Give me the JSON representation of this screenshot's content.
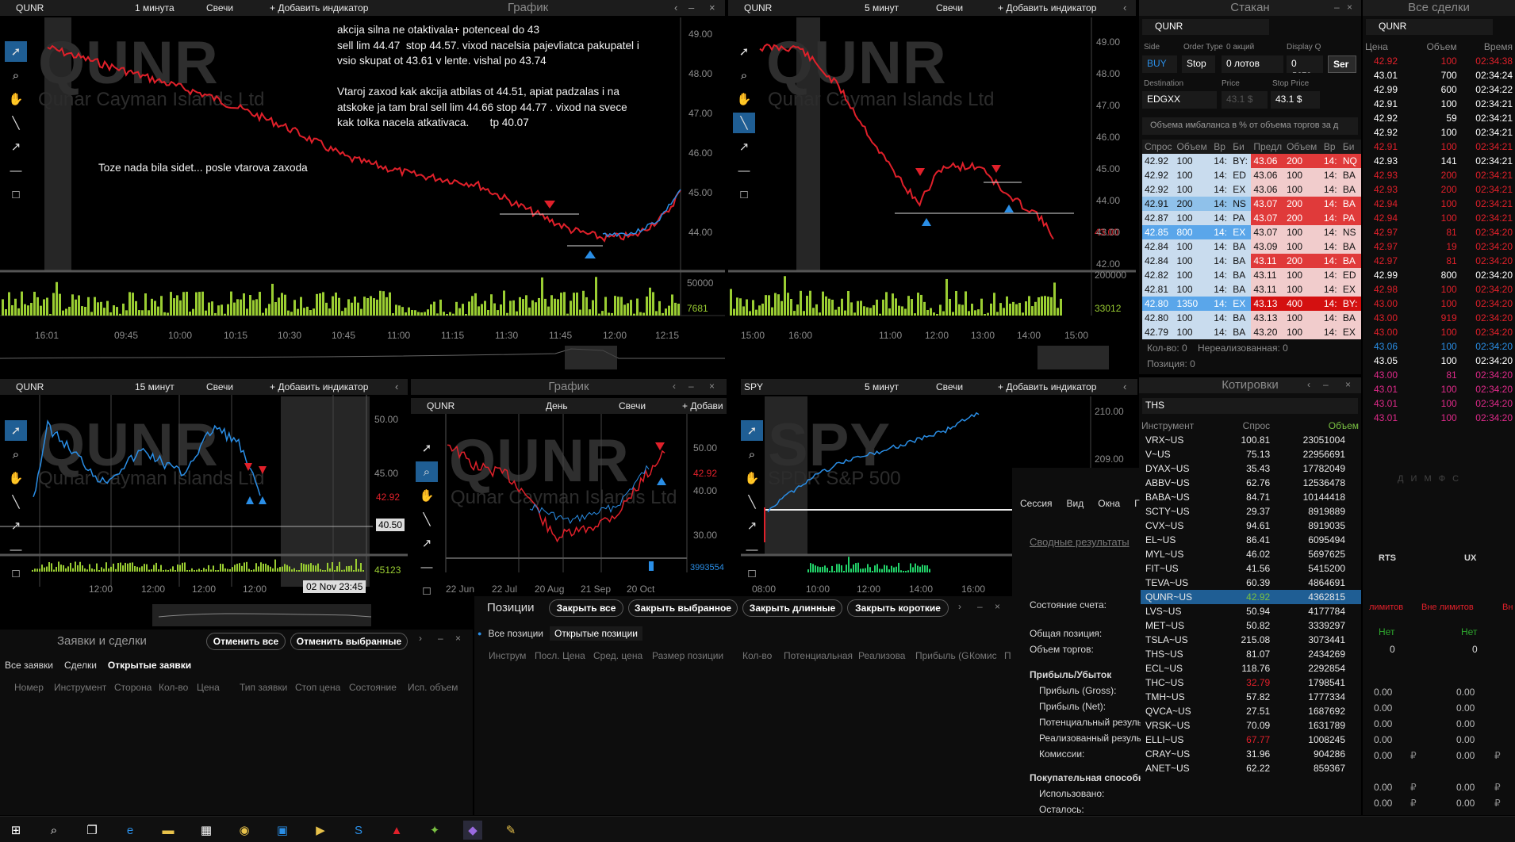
{
  "colors": {
    "up": "#2a8ee6",
    "down": "#e0202a",
    "vol": "#9acd32",
    "accent": "#1f5e94",
    "bid": "#cfe3f5",
    "ask": "#f0c8c8"
  },
  "chart1": {
    "symbol": "QUNR",
    "interval": "1 минута",
    "type": "Свечи",
    "add": "+ Добавить индикатор",
    "title": "График",
    "wm_symbol": "QUNR",
    "wm_name": "Qunar Cayman Islands Ltd",
    "prices": [
      "49.00",
      "48.00",
      "47.00",
      "46.00",
      "45.00",
      "44.00"
    ],
    "vol_labels": [
      "50000",
      "7681"
    ],
    "times": [
      "16:01",
      "09:45",
      "10:00",
      "10:15",
      "10:30",
      "10:45",
      "11:00",
      "11:15",
      "11:30",
      "11:45",
      "12:00",
      "12:15"
    ],
    "note1": "akcija silna ne otaktivala+ potenceal do 43\nsell lim 44.47  stop 44.57. vixod nacelsia pajevliatca pakupatel i\nvsio skupat ot 43.61 v lente. vishal po 43.74\n\nVtaroj zaxod kak akcija atbilas ot 44.51, apiat padzalas i na\natskoke ja tam bral sell lim 44.66 stop 44.77 . vixod na svece\nkak tolka nacela atkativaca.       tp 40.07",
    "note2": "Toze nada bila sidet... posle vtarova zaxoda"
  },
  "chart2": {
    "symbol": "QUNR",
    "interval": "5 минут",
    "type": "Свечи",
    "add": "+ Добавить индикатор",
    "wm_symbol": "QUNR",
    "wm_name": "Qunar Cayman Islands Ltd",
    "prices": [
      "49.00",
      "48.00",
      "47.00",
      "46.00",
      "45.00",
      "44.00",
      "43.00",
      "42.00"
    ],
    "last": "43.00",
    "vol_labels": [
      "200000",
      "33012"
    ],
    "times": [
      "15:00",
      "16:00",
      "11:00",
      "12:00",
      "13:00",
      "14:00",
      "15:00"
    ]
  },
  "chart3": {
    "symbol": "QUNR",
    "interval": "15 минут",
    "type": "Свечи",
    "add": "+ Добавить индикатор",
    "wm_symbol": "QUNR",
    "wm_name": "Qunar Cayman Islands Ltd",
    "prices": [
      "50.00",
      "45.00"
    ],
    "last": "42.92",
    "cursor": "40.50",
    "vol_label": "45123",
    "times": [
      "12:00",
      "12:00",
      "12:00",
      "12:00"
    ],
    "tooltip": "02 Nov 23:45"
  },
  "chart4": {
    "symbol": "QUNR",
    "title": "График",
    "interval": "День",
    "type": "Свечи",
    "add": "+ Добави",
    "wm_symbol": "QUNR",
    "wm_name": "Qunar Cayman Islands Ltd",
    "prices": [
      "50.00",
      "40.00",
      "30.00"
    ],
    "last": "42.92",
    "vol_label": "3993554",
    "times": [
      "22 Jun",
      "22 Jul",
      "20 Aug",
      "21 Sep",
      "20 Oct"
    ]
  },
  "chart5": {
    "symbol": "SPY",
    "interval": "5 минут",
    "type": "Свечи",
    "add": "+ Добавить индикатор",
    "wm_symbol": "SPY",
    "wm_name": "SPDR S&P 500",
    "prices": [
      "210.00",
      "209.00"
    ],
    "times": [
      "08:00",
      "10:00",
      "12:00",
      "14:00",
      "16:00"
    ]
  },
  "dom": {
    "title": "Стакан",
    "symbol": "QUNR",
    "side_label": "Side",
    "side": "BUY",
    "ordertype_label": "Order Type",
    "ordertype": "Stop",
    "qty_label": "0 акций",
    "qty": "0 лотов",
    "display_label": "Display Q",
    "display": "0 лото",
    "send": "Ser",
    "dest_label": "Destination",
    "dest": "EDGXX",
    "price_label": "Price",
    "price": "43.1 $",
    "stop_label": "Stop Price",
    "stop": "43.1 $",
    "imbalance": "Объема имбаланса в % от объема торгов за д",
    "headers": [
      "Спрос",
      "Объем",
      "Вр",
      "Би",
      "Предл",
      "Объем",
      "Вр",
      "Би"
    ],
    "rows": [
      [
        "42.92",
        "100",
        "14:",
        "BY:",
        "43.06",
        "200",
        "14:",
        "NQ"
      ],
      [
        "42.92",
        "100",
        "14:",
        "ED",
        "43.06",
        "100",
        "14:",
        "BA"
      ],
      [
        "42.92",
        "100",
        "14:",
        "EX",
        "43.06",
        "100",
        "14:",
        "BA"
      ],
      [
        "42.91",
        "200",
        "14:",
        "NS",
        "43.07",
        "200",
        "14:",
        "BA"
      ],
      [
        "42.87",
        "100",
        "14:",
        "PA",
        "43.07",
        "200",
        "14:",
        "PA"
      ],
      [
        "42.85",
        "800",
        "14:",
        "EX",
        "43.07",
        "100",
        "14:",
        "NS"
      ],
      [
        "42.84",
        "100",
        "14:",
        "BA",
        "43.09",
        "100",
        "14:",
        "BA"
      ],
      [
        "42.84",
        "100",
        "14:",
        "BA",
        "43.11",
        "200",
        "14:",
        "BA"
      ],
      [
        "42.82",
        "100",
        "14:",
        "BA",
        "43.11",
        "100",
        "14:",
        "ED"
      ],
      [
        "42.81",
        "100",
        "14:",
        "BA",
        "43.11",
        "100",
        "14:",
        "EX"
      ],
      [
        "42.80",
        "1350",
        "14:",
        "EX",
        "43.13",
        "400",
        "14:",
        "BY:"
      ],
      [
        "42.80",
        "100",
        "14:",
        "BA",
        "43.13",
        "100",
        "14:",
        "BA"
      ],
      [
        "42.79",
        "100",
        "14:",
        "BA",
        "43.20",
        "100",
        "14:",
        "EX"
      ]
    ],
    "qty_footer": "Кол-во: 0",
    "unreal": "Нереализованная: 0",
    "pos": "Позиция: 0"
  },
  "trades": {
    "title": "Все сделки",
    "symbol": "QUNR",
    "headers": [
      "Цена",
      "Объем",
      "Время"
    ],
    "rows": [
      [
        "42.92",
        "100",
        "02:34:38",
        "r"
      ],
      [
        "43.01",
        "700",
        "02:34:24",
        "w"
      ],
      [
        "42.99",
        "600",
        "02:34:22",
        "w"
      ],
      [
        "42.91",
        "100",
        "02:34:21",
        "w"
      ],
      [
        "42.92",
        "59",
        "02:34:21",
        "w"
      ],
      [
        "42.92",
        "100",
        "02:34:21",
        "w"
      ],
      [
        "42.91",
        "100",
        "02:34:21",
        "r"
      ],
      [
        "42.93",
        "141",
        "02:34:21",
        "w"
      ],
      [
        "42.93",
        "200",
        "02:34:21",
        "r"
      ],
      [
        "42.93",
        "200",
        "02:34:21",
        "r"
      ],
      [
        "42.94",
        "100",
        "02:34:21",
        "r"
      ],
      [
        "42.94",
        "100",
        "02:34:21",
        "r"
      ],
      [
        "42.97",
        "81",
        "02:34:20",
        "r"
      ],
      [
        "42.97",
        "19",
        "02:34:20",
        "r"
      ],
      [
        "42.97",
        "81",
        "02:34:20",
        "r"
      ],
      [
        "42.99",
        "800",
        "02:34:20",
        "w"
      ],
      [
        "42.98",
        "100",
        "02:34:20",
        "r"
      ],
      [
        "43.00",
        "100",
        "02:34:20",
        "r"
      ],
      [
        "43.00",
        "919",
        "02:34:20",
        "r"
      ],
      [
        "43.00",
        "100",
        "02:34:20",
        "r"
      ],
      [
        "43.06",
        "100",
        "02:34:20",
        "b"
      ],
      [
        "43.05",
        "100",
        "02:34:20",
        "w"
      ],
      [
        "43.00",
        "81",
        "02:34:20",
        "m"
      ],
      [
        "43.01",
        "100",
        "02:34:20",
        "m"
      ],
      [
        "43.01",
        "100",
        "02:34:20",
        "m"
      ],
      [
        "43.01",
        "100",
        "02:34:20",
        "m"
      ]
    ],
    "footer": "Д И М Ф С"
  },
  "quotes": {
    "title": "Котировки",
    "list": "THS",
    "headers": [
      "Инструмент",
      "Спрос",
      "Объем"
    ],
    "rows": [
      [
        "VRX~US",
        "100.81",
        "23051004"
      ],
      [
        "V~US",
        "75.13",
        "22956691"
      ],
      [
        "DYAX~US",
        "35.43",
        "17782049"
      ],
      [
        "ABBV~US",
        "62.76",
        "12536478"
      ],
      [
        "BABA~US",
        "84.71",
        "10144418"
      ],
      [
        "SCTY~US",
        "29.37",
        "8919889"
      ],
      [
        "CVX~US",
        "94.61",
        "8919035"
      ],
      [
        "EL~US",
        "86.41",
        "6095494"
      ],
      [
        "MYL~US",
        "46.02",
        "5697625"
      ],
      [
        "FIT~US",
        "41.56",
        "5415200"
      ],
      [
        "TEVA~US",
        "60.39",
        "4864691"
      ],
      [
        "QUNR~US",
        "42.92",
        "4362815"
      ],
      [
        "LVS~US",
        "50.94",
        "4177784"
      ],
      [
        "MET~US",
        "50.82",
        "3339297"
      ],
      [
        "TSLA~US",
        "215.08",
        "3073441"
      ],
      [
        "THS~US",
        "81.07",
        "2434269"
      ],
      [
        "ECL~US",
        "118.76",
        "2292854"
      ],
      [
        "THC~US",
        "32.79",
        "1798541"
      ],
      [
        "TMH~US",
        "57.82",
        "1777334"
      ],
      [
        "QVCA~US",
        "27.51",
        "1687692"
      ],
      [
        "VRSK~US",
        "70.09",
        "1631789"
      ],
      [
        "ELLI~US",
        "67.77",
        "1008245"
      ],
      [
        "CRAY~US",
        "31.96",
        "904286"
      ],
      [
        "ANET~US",
        "62.22",
        "859367"
      ]
    ],
    "selected": 11
  },
  "account": {
    "menu": [
      "Сессия",
      "Вид",
      "Окна",
      "Г"
    ],
    "summary": "Сводные результаты",
    "state": "Состояние счета:",
    "total_pos": "Общая позиция:",
    "volume": "Объем торгов:",
    "pnl": "Прибыль/Убыток",
    "gross": "Прибыль (Gross):",
    "net": "Прибыль (Net):",
    "potential": "Потенциальный резуль",
    "realized": "Реализованный резуль",
    "commission": "Комиссии:",
    "buying": "Покупательная способн",
    "used": "Использовано:",
    "left": "Осталось:",
    "col1": "RTS",
    "col2": "UX",
    "limits1": "лимитов",
    "limits2": "Вне лимитов",
    "limits3": "Вн",
    "no1": "Нет",
    "no2": "Нет",
    "zero": "0",
    "z": "0.00",
    "cur": "₽"
  },
  "orders": {
    "title": "Заявки и сделки",
    "cancel_all": "Отменить все",
    "cancel_sel": "Отменить выбранные",
    "tabs": [
      "Все заявки",
      "Сделки",
      "Открытые заявки"
    ],
    "cols": [
      "Номер",
      "Инструмент",
      "Сторона",
      "Кол-во",
      "Цена",
      "Тип заявки",
      "Стоп цена",
      "Состояние",
      "Исп. объем"
    ]
  },
  "positions": {
    "title": "Позиции",
    "btns": [
      "Закрыть все",
      "Закрыть выбранное",
      "Закрыть длинные",
      "Закрыть короткие"
    ],
    "tabs": [
      "Все позиции",
      "Открытые позиции"
    ],
    "cols": [
      "Инструм",
      "Посл. Цена",
      "Сред. цена",
      "Размер позиции",
      "Кол-во",
      "Потенциальная",
      "Реализова",
      "Прибыль (G",
      "Комис",
      "П"
    ]
  }
}
